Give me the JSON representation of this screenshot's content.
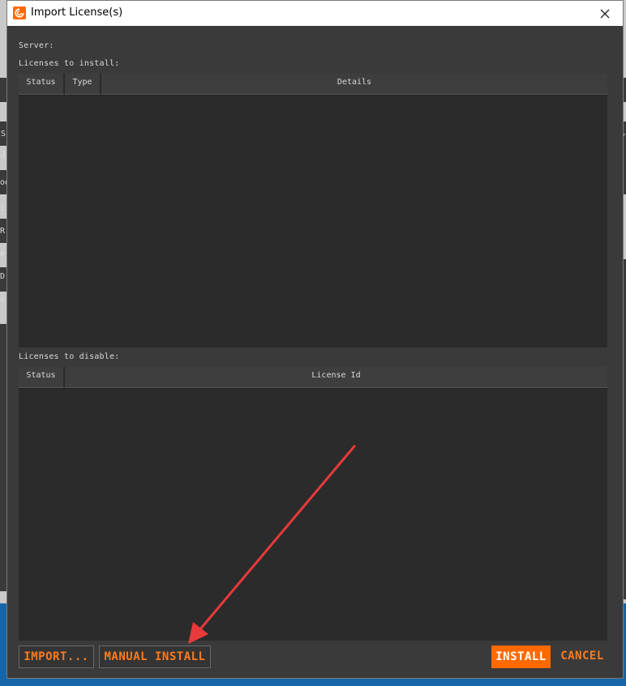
{
  "window": {
    "title": "Import License(s)",
    "icons": {
      "app": "houdini-logo-icon",
      "close": "close-icon"
    }
  },
  "server": {
    "label": "Server:"
  },
  "install_section": {
    "label": "Licenses to install:",
    "columns": [
      "Status",
      "Type",
      "Details"
    ],
    "rows": []
  },
  "disable_section": {
    "label": "Licenses to disable:",
    "columns": [
      "Status",
      "License Id"
    ],
    "rows": []
  },
  "buttons": {
    "import": "IMPORT...",
    "manual_install": "MANUAL INSTALL",
    "install": "INSTALL",
    "cancel": "CANCEL"
  },
  "colors": {
    "accent": "#ff6a00",
    "annotation_arrow": "#e83a3a",
    "panel": "#3a3a3a"
  },
  "background_app": {
    "visible_fragments": [
      "S",
      "J",
      "od",
      "i",
      "R",
      "e:",
      "D(",
      "i",
      "Y"
    ]
  }
}
